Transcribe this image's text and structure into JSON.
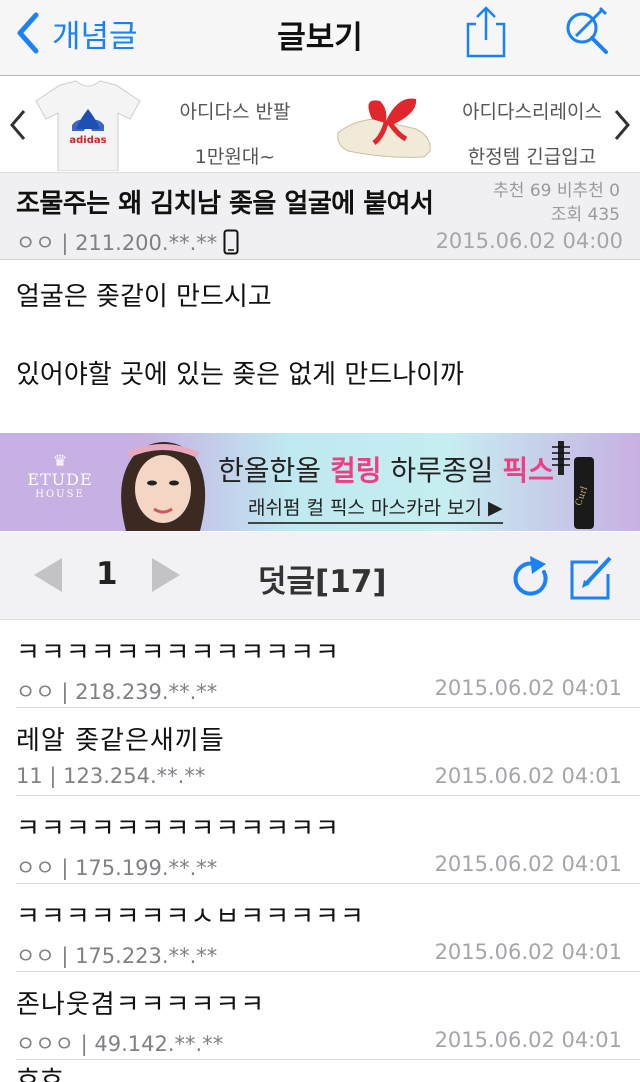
{
  "navbar": {
    "back_label": "개념글",
    "title": "글보기"
  },
  "ads": [
    {
      "title": "아디다스 반팔",
      "subtitle": "1만원대~",
      "brand_text": "adidas"
    },
    {
      "title": "아디다스리레이스",
      "subtitle": "한정템 긴급입고"
    }
  ],
  "post": {
    "title": "조물주는 왜 김치남 좆을 얼굴에 붙여서",
    "votes_line": "추천 69 비추천 0",
    "views_line": "조회 435",
    "author_ip": "ㅇㅇ | 211.200.**.**",
    "date": "2015.06.02 04:00",
    "body": [
      "얼굴은 좆같이 만드시고",
      "있어야할 곳에 있는 좆은 없게 만드나이까"
    ]
  },
  "banner": {
    "brand": "ETUDE",
    "brand_sub": "HOUSE",
    "main_pre": "한올한올 ",
    "main_pink1": "컬링",
    "main_mid": " 하루종일 ",
    "main_pink2": "픽스",
    "sub": "래쉬펌 컬 픽스 마스카라 보기 ▶",
    "accent": "#ee3f86"
  },
  "comment_bar": {
    "page": "1",
    "title": "덧글[17]",
    "accent": "#1a82f6"
  },
  "comments": [
    {
      "text": "ㅋㅋㅋㅋㅋㅋㅋㅋㅋㅋㅋㅋㅋ",
      "meta": "ㅇㅇ | 218.239.**.**",
      "date": "2015.06.02 04:01"
    },
    {
      "text": "레알 좆같은새끼들",
      "meta": "11 | 123.254.**.**",
      "date": "2015.06.02 04:01"
    },
    {
      "text": "ㅋㅋㅋㅋㅋㅋㅋㅋㅋㅋㅋㅋㅋ",
      "meta": "ㅇㅇ | 175.199.**.**",
      "date": "2015.06.02 04:01"
    },
    {
      "text": "ㅋㅋㅋㅋㅋㅋㅋㅅㅂㅋㅋㅋㅋㅋ",
      "meta": "ㅇㅇ | 175.223.**.**",
      "date": "2015.06.02 04:01"
    },
    {
      "text": "존나웃겸ㅋㅋㅋㅋㅋㅋ",
      "meta": "ㅇㅇㅇ | 49.142.**.**",
      "date": "2015.06.02 04:01"
    }
  ],
  "partial_comment": "흐흐"
}
